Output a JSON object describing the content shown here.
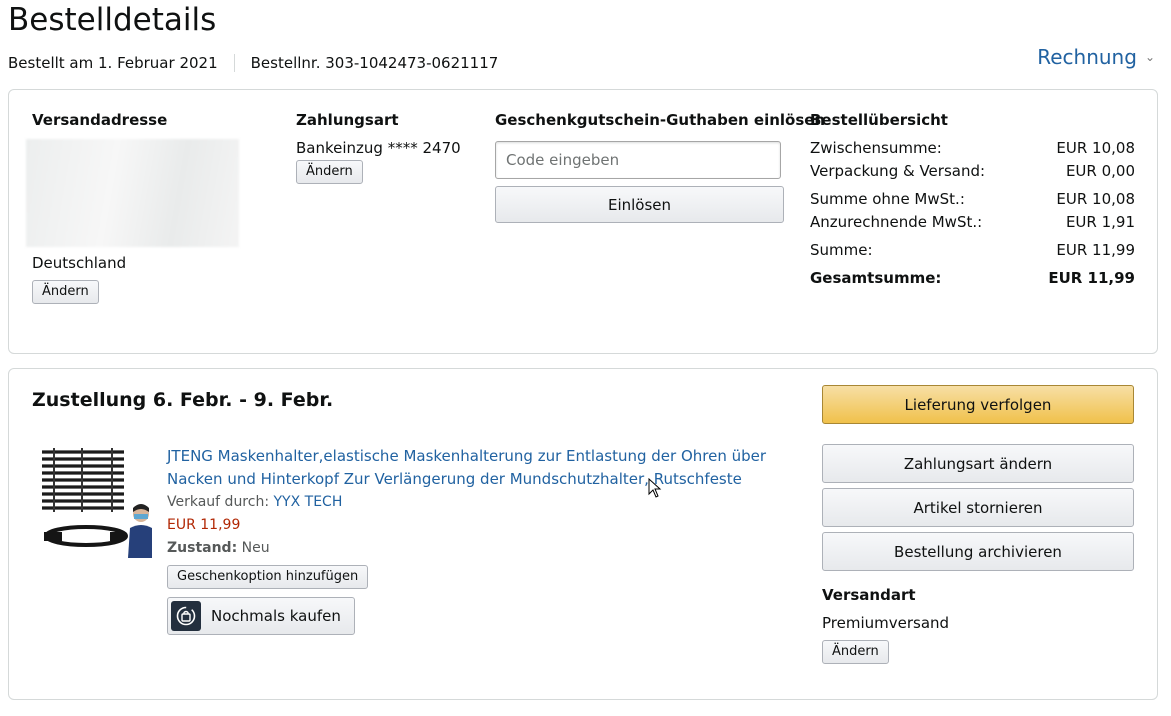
{
  "page": {
    "title": "Bestelldetails",
    "ordered_on": "Bestellt am 1. Februar 2021",
    "order_number": "Bestellnr. 303-1042473-0621117",
    "invoice_label": "Rechnung"
  },
  "shipping_address": {
    "heading": "Versandadresse",
    "country": "Deutschland",
    "change_label": "Ändern"
  },
  "payment": {
    "heading": "Zahlungsart",
    "method": "Bankeinzug **** 2470",
    "change_label": "Ändern"
  },
  "gift_card": {
    "heading": "Geschenkgutschein-Guthaben einlösen",
    "placeholder": "Code eingeben",
    "value": "",
    "redeem_label": "Einlösen"
  },
  "summary": {
    "heading": "Bestellübersicht",
    "rows": [
      {
        "label": "Zwischensumme:",
        "value": "EUR 10,08"
      },
      {
        "label": "Verpackung & Versand:",
        "value": "EUR 0,00"
      },
      {
        "label": "Summe ohne MwSt.:",
        "value": "EUR 10,08"
      },
      {
        "label": "Anzurechnende MwSt.:",
        "value": "EUR 1,91"
      },
      {
        "label": "Summe:",
        "value": "EUR 11,99"
      },
      {
        "label": "Gesamtsumme:",
        "value": "EUR 11,99"
      }
    ]
  },
  "shipment": {
    "delivery_heading": "Zustellung 6. Febr. - 9. Febr.",
    "item": {
      "title": "JTENG Maskenhalter,elastische Maskenhalterung zur Entlastung der Ohren über Nacken und Hinterkopf Zur Verlängerung der Mundschutzhalter, Rutschfeste",
      "sold_by_label": "Verkauf durch:",
      "seller": "YYX TECH",
      "price": "EUR 11,99",
      "condition_label": "Zustand:",
      "condition": "Neu",
      "gift_option_label": "Geschenkoption hinzufügen",
      "buy_again_label": "Nochmals kaufen"
    },
    "actions": {
      "track": "Lieferung verfolgen",
      "change_payment": "Zahlungsart ändern",
      "cancel": "Artikel stornieren",
      "archive": "Bestellung archivieren"
    },
    "shipping_method": {
      "heading": "Versandart",
      "value": "Premiumversand",
      "change_label": "Ändern"
    }
  },
  "colors": {
    "link": "#2162a1",
    "price": "#b12704",
    "primary_button": "#f0c14b",
    "border": "#d5d9d9"
  }
}
